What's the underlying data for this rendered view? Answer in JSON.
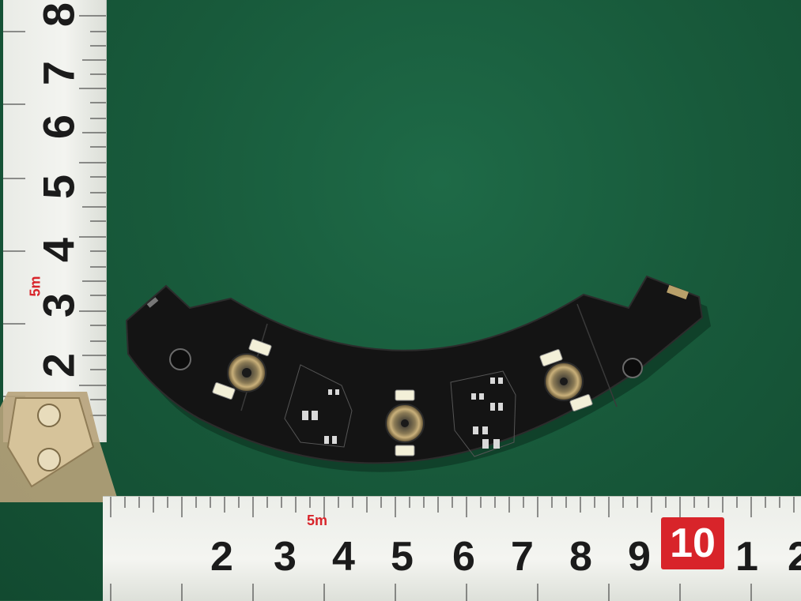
{
  "ruler_vertical": {
    "numbers": [
      "8",
      "7",
      "6",
      "5",
      "4",
      "3",
      "2"
    ],
    "mark": "5m"
  },
  "ruler_horizontal": {
    "numbers": [
      "2",
      "3",
      "4",
      "5",
      "6",
      "7",
      "8",
      "9",
      "1",
      "2"
    ],
    "highlight": "10",
    "mark": "5m"
  },
  "colors": {
    "mat": "#185a3b",
    "pcb": "#121212",
    "ruler": "#eef0eb",
    "ruler_red": "#d8242a",
    "clip": "#c9b58f"
  }
}
